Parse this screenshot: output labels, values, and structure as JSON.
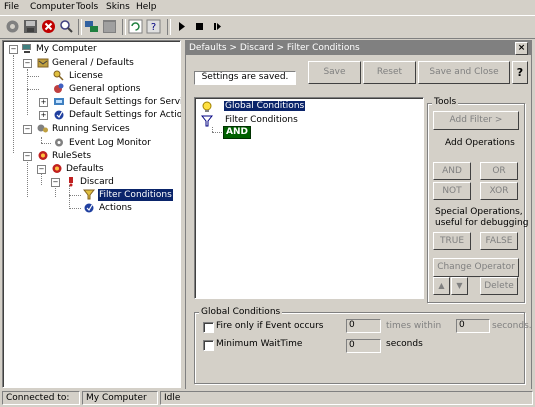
{
  "menu": {
    "file": "File",
    "computer": "Computer",
    "tools": "Tools",
    "skins": "Skins",
    "help": "Help"
  },
  "toolbar": {
    "icons": [
      "settings-icon",
      "save-icon",
      "stop-icon",
      "search-icon",
      "network-icon",
      "window-icon",
      "refresh-icon",
      "help-icon",
      "play-icon",
      "stop-square-icon",
      "pause-icon"
    ]
  },
  "tree": {
    "my_computer": "My Computer",
    "general_defaults": "General / Defaults",
    "license": "License",
    "general_options": "General options",
    "default_services": "Default Settings for Services",
    "default_actions": "Default Settings for Actions",
    "running_services": "Running Services",
    "event_log_monitor": "Event Log Monitor",
    "rulesets": "RuleSets",
    "defaults": "Defaults",
    "discard": "Discard",
    "filter_conditions": "Filter Conditions",
    "actions": "Actions"
  },
  "panel": {
    "title": "Defaults > Discard > Filter Conditions",
    "close": "×",
    "status": "Settings are saved.",
    "save": "Save",
    "reset": "Reset",
    "save_close": "Save and Close",
    "help": "?"
  },
  "conditions": {
    "global": "Global Conditions",
    "filter": "Filter Conditions",
    "and": "AND"
  },
  "tools": {
    "group": "Tools",
    "add_filter": "Add Filter >",
    "add_operations": "Add Operations",
    "and": "AND",
    "or": "OR",
    "not": "NOT",
    "xor": "XOR",
    "special": "Special Operations,",
    "special2": "useful for debugging",
    "true": "TRUE",
    "false": "FALSE",
    "change_operator": "Change Operator",
    "up": "▲",
    "down": "▼",
    "delete": "Delete"
  },
  "global_conditions": {
    "group": "Global Conditions",
    "fire_only": "Fire only if Event occurs",
    "fire_value": "0",
    "times_within": "times within",
    "within_value": "0",
    "seconds1": "seconds.",
    "min_wait": "Minimum WaitTime",
    "wait_value": "0",
    "seconds2": "seconds"
  },
  "status": {
    "connected_to": "Connected to:",
    "computer": "My Computer",
    "state": "Idle"
  }
}
